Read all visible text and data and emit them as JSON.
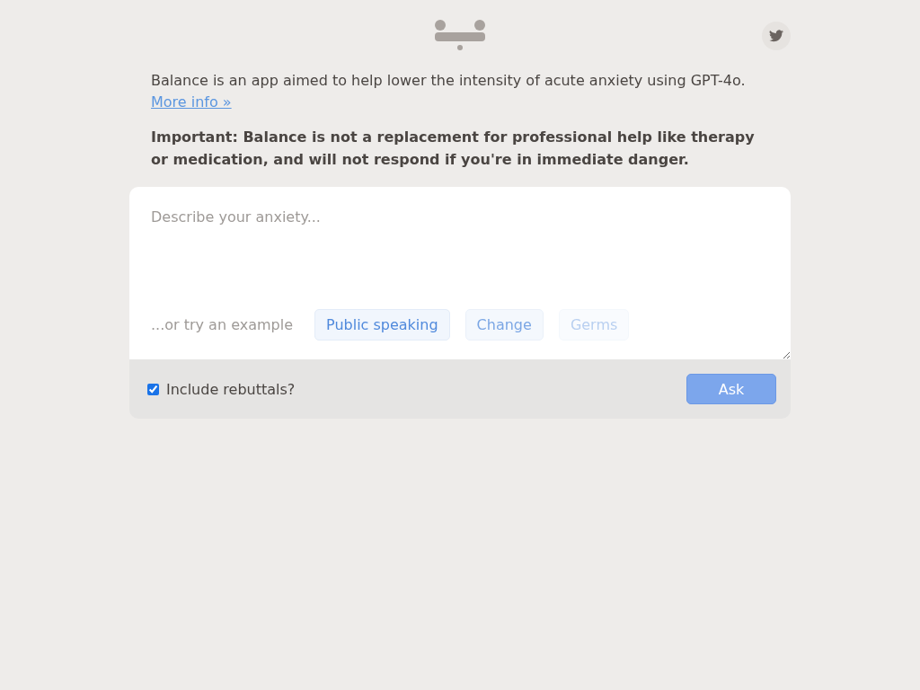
{
  "intro": {
    "text": "Balance is an app aimed to help lower the intensity of acute anxiety using GPT-4o.",
    "link": "More info »"
  },
  "notice": "Important: Balance is not a replacement for professional help like therapy or medication, and will not respond if you're in immediate danger.",
  "prompt": {
    "placeholder": "Describe your anxiety...",
    "examples_label": "...or try an example",
    "examples": [
      {
        "label": "Public speaking",
        "kind": "full"
      },
      {
        "label": "Change",
        "kind": "half"
      },
      {
        "label": "Germs",
        "kind": "faint"
      }
    ]
  },
  "rebuttals": {
    "label": "Include rebuttals?",
    "checked": true
  },
  "ask_button": {
    "label": "Ask",
    "disabled": true
  }
}
